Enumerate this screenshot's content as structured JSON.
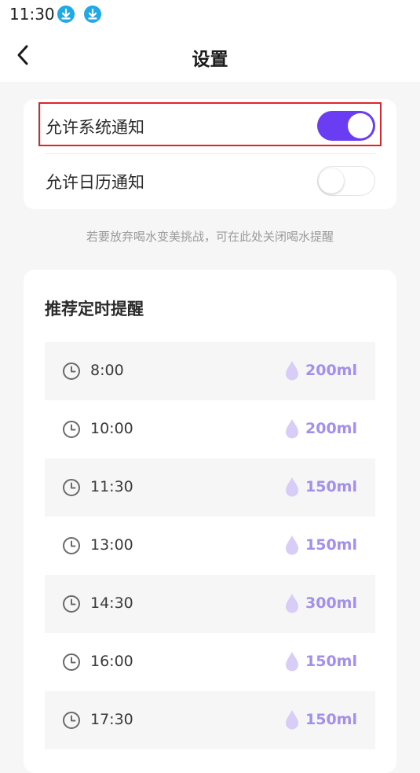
{
  "status_bar": {
    "time": "11:30",
    "icons": [
      "download-icon",
      "download-icon"
    ]
  },
  "header": {
    "title": "设置",
    "back_icon": "chevron-left-icon"
  },
  "notifications": {
    "items": [
      {
        "label": "允许系统通知",
        "enabled": true
      },
      {
        "label": "允许日历通知",
        "enabled": false
      }
    ]
  },
  "hint": "若要放弃喝水变美挑战，可在此处关闭喝水提醒",
  "schedule": {
    "title": "推荐定时提醒",
    "items": [
      {
        "time": "8:00",
        "amount": "200ml"
      },
      {
        "time": "10:00",
        "amount": "200ml"
      },
      {
        "time": "11:30",
        "amount": "150ml"
      },
      {
        "time": "13:00",
        "amount": "150ml"
      },
      {
        "time": "14:30",
        "amount": "300ml"
      },
      {
        "time": "16:00",
        "amount": "150ml"
      },
      {
        "time": "17:30",
        "amount": "150ml"
      }
    ]
  },
  "colors": {
    "accent": "#6a3df2",
    "amount_text": "#a290ea",
    "drop_fill": "#d8cdf7",
    "highlight_border": "#e0232b"
  }
}
